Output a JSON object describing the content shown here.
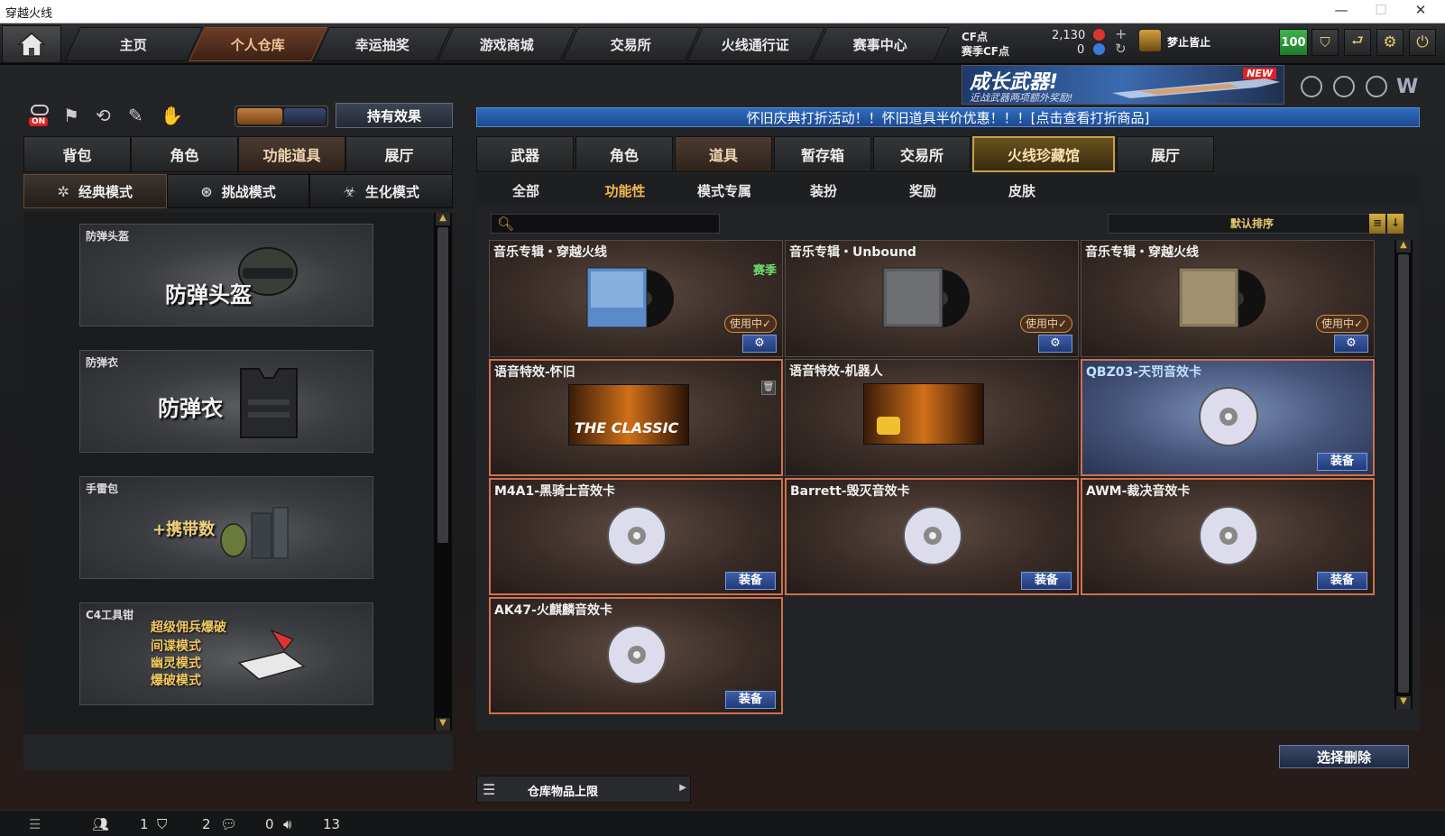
{
  "window": {
    "title": "穿越火线"
  },
  "nav": {
    "tabs": [
      "主页",
      "个人仓库",
      "幸运抽奖",
      "游戏商城",
      "交易所",
      "火线通行证",
      "赛事中心"
    ],
    "active_index": 1
  },
  "currency": {
    "cf_label": "CF点",
    "cf_value": "2,130",
    "season_label": "赛季CF点",
    "season_value": "0"
  },
  "user": {
    "name": "梦止皆止",
    "level_badge": "100"
  },
  "banner": {
    "title": "成长武器!",
    "subtitle": "近战武器两项额外奖励!",
    "tag": "NEW"
  },
  "left": {
    "on_badge": "ON",
    "hold_effect_button": "持有效果",
    "tabs": [
      "背包",
      "角色",
      "功能道具",
      "展厅"
    ],
    "active_tab": 2,
    "modes": [
      "经典模式",
      "挑战模式",
      "生化模式"
    ],
    "items": [
      {
        "label": "防弹头盔",
        "art_text": "防弹头盔"
      },
      {
        "label": "防弹衣",
        "art_text": "防弹衣"
      },
      {
        "label": "手雷包",
        "art_text": "+携带数"
      },
      {
        "label": "C4工具钳",
        "art_lines": [
          "超级佣兵爆破",
          "间谍模式",
          "幽灵模式",
          "爆破模式"
        ]
      }
    ]
  },
  "notice": "怀旧庆典打折活动！！怀旧道具半价优惠！！！[点击查看打折商品]",
  "right": {
    "tabs": [
      "武器",
      "角色",
      "道具",
      "暂存箱",
      "交易所",
      "火线珍藏馆",
      "展厅"
    ],
    "active_tab": 2,
    "subtabs": [
      "全部",
      "功能性",
      "模式专属",
      "装扮",
      "奖励",
      "皮肤"
    ],
    "active_subtab": 1,
    "search_placeholder": "",
    "sort_label": "默认排序",
    "cards": [
      {
        "name": "音乐专辑・穿越火线",
        "tag": "赛季",
        "status": "使用中✓",
        "kind": "album"
      },
      {
        "name": "音乐专辑・Unbound",
        "status": "使用中✓",
        "kind": "album"
      },
      {
        "name": "音乐专辑・穿越火线",
        "status": "使用中✓",
        "kind": "album"
      },
      {
        "name": "语音特效-怀旧",
        "art_text": "THE CLASSIC",
        "kind": "voice"
      },
      {
        "name": "语音特效-机器人",
        "kind": "voice"
      },
      {
        "name": "QBZ03-天罚音效卡",
        "equip": "装备",
        "kind": "sound"
      },
      {
        "name": "M4A1-黑骑士音效卡",
        "equip": "装备",
        "kind": "sound"
      },
      {
        "name": "Barrett-毁灭音效卡",
        "equip": "装备",
        "kind": "sound"
      },
      {
        "name": "AWM-裁决音效卡",
        "equip": "装备",
        "kind": "sound"
      },
      {
        "name": "AK47-火麒麟音效卡",
        "equip": "装备",
        "kind": "sound"
      }
    ],
    "delete_button": "选择删除",
    "capacity_label": "仓库物品上限"
  },
  "statusbar": {
    "a": "1",
    "b": "2",
    "c": "0",
    "d": "13"
  }
}
